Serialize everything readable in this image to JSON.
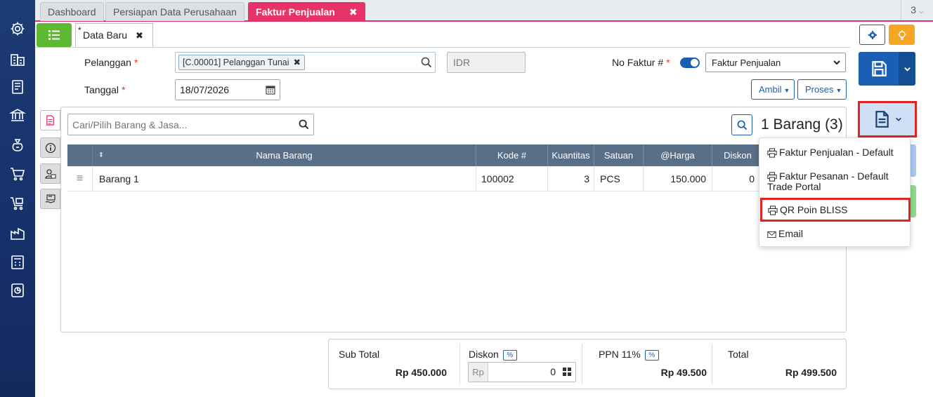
{
  "tabs": [
    {
      "label": "Dashboard"
    },
    {
      "label": "Persiapan Data Perusahaan"
    },
    {
      "label": "Faktur Penjualan",
      "active": true,
      "close": "✖"
    }
  ],
  "tab_count": "3",
  "document_tab": {
    "star": "*",
    "label": "Data Baru",
    "close": "✖"
  },
  "form": {
    "customer_label": "Pelanggan",
    "customer_value": "[C.00001] Pelanggan Tunai",
    "chip_remove": "✖",
    "currency_placeholder": "IDR",
    "invoice_no_label": "No Faktur #",
    "invoice_type_value": "Faktur Penjualan",
    "date_label": "Tanggal",
    "date_value": "18/07/2026",
    "required_mark": "*",
    "take_button": "Ambil",
    "process_button": "Proses"
  },
  "items": {
    "search_placeholder": "Cari/Pilih Barang & Jasa...",
    "count_label": "1 Barang (3)",
    "columns": {
      "sort": "⬍",
      "name": "Nama Barang",
      "code": "Kode #",
      "qty": "Kuantitas",
      "unit": "Satuan",
      "price": "@Harga",
      "discount": "Diskon"
    },
    "rows": [
      {
        "handle": "≡",
        "name": "Barang 1",
        "code": "100002",
        "qty": "3",
        "unit": "PCS",
        "price": "150.000",
        "discount": "0"
      }
    ]
  },
  "print_menu": {
    "items": [
      {
        "label": "Faktur Penjualan - Default"
      },
      {
        "label": "Faktur Pesanan - Default",
        "label2": "Trade Portal"
      },
      {
        "label": "QR Poin BLISS"
      },
      {
        "label": "Email"
      }
    ]
  },
  "totals": {
    "subtotal_label": "Sub Total",
    "subtotal_value": "Rp 450.000",
    "discount_label": "Diskon",
    "discount_pct": "%",
    "discount_currency": "Rp",
    "discount_value": "0",
    "tax_label": "PPN 11%",
    "tax_pct": "%",
    "tax_value": "Rp 49.500",
    "total_label": "Total",
    "total_value": "Rp 499.500"
  },
  "colors": {
    "sidebar": "#1d3b74",
    "accent_pink": "#e8336a",
    "primary_blue": "#1a5fb4",
    "green": "#5fb832",
    "highlight_red": "#e02424"
  }
}
